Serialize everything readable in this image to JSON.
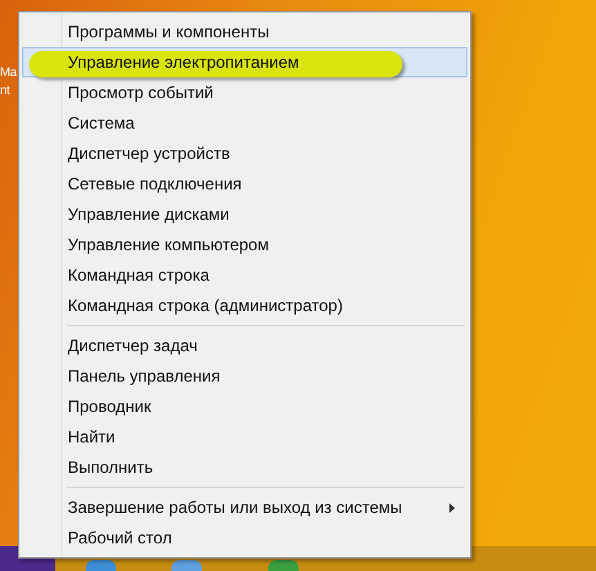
{
  "desktop_icon_labels": [
    "Ma",
    "nt"
  ],
  "context_menu": {
    "groups": [
      {
        "items": [
          {
            "label": "Программы и компоненты",
            "selected": false
          },
          {
            "label": "Управление электропитанием",
            "selected": true
          },
          {
            "label": "Просмотр событий",
            "selected": false
          },
          {
            "label": "Система",
            "selected": false
          },
          {
            "label": "Диспетчер устройств",
            "selected": false
          },
          {
            "label": "Сетевые подключения",
            "selected": false
          },
          {
            "label": "Управление дисками",
            "selected": false
          },
          {
            "label": "Управление компьютером",
            "selected": false
          },
          {
            "label": "Командная строка",
            "selected": false
          },
          {
            "label": "Командная строка (администратор)",
            "selected": false
          }
        ]
      },
      {
        "items": [
          {
            "label": "Диспетчер задач",
            "selected": false
          },
          {
            "label": "Панель управления",
            "selected": false
          },
          {
            "label": "Проводник",
            "selected": false
          },
          {
            "label": "Найти",
            "selected": false
          },
          {
            "label": "Выполнить",
            "selected": false
          }
        ]
      },
      {
        "items": [
          {
            "label": "Завершение работы или выход из системы",
            "selected": false,
            "submenu": true
          },
          {
            "label": "Рабочий стол",
            "selected": false
          }
        ]
      }
    ]
  }
}
